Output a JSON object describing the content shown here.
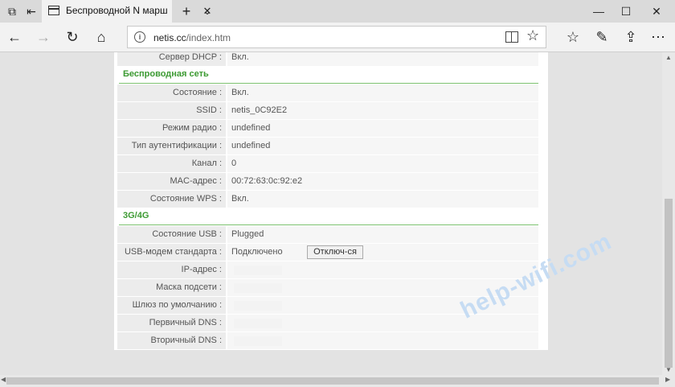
{
  "browser": {
    "tab_title": "Беспроводной N марш",
    "url_host": "netis.cc",
    "url_path": "/index.htm"
  },
  "rows_top": [
    {
      "label": "Сервер DHCP :",
      "value": "Вкл."
    }
  ],
  "sections": [
    {
      "title": "Беспроводная сеть",
      "rows": [
        {
          "label": "Состояние :",
          "value": "Вкл."
        },
        {
          "label": "SSID :",
          "value": "netis_0C92E2"
        },
        {
          "label": "Режим радио :",
          "value": "undefined"
        },
        {
          "label": "Тип аутентификации :",
          "value": "undefined"
        },
        {
          "label": "Канал :",
          "value": "0"
        },
        {
          "label": "MAC-адрес :",
          "value": "00:72:63:0c:92:e2"
        },
        {
          "label": "Состояние WPS :",
          "value": "Вкл."
        }
      ]
    },
    {
      "title": "3G/4G",
      "rows": [
        {
          "label": "Состояние USB :",
          "value": "Plugged"
        },
        {
          "label": "USB-модем стандарта :",
          "value": "Подключено",
          "button": "Отключ-ся"
        },
        {
          "label": "IP-адрес :",
          "value": ""
        },
        {
          "label": "Маска подсети :",
          "value": ""
        },
        {
          "label": "Шлюз по умолчанию :",
          "value": ""
        },
        {
          "label": "Первичный DNS :",
          "value": ""
        },
        {
          "label": "Вторичный DNS :",
          "value": ""
        }
      ]
    }
  ],
  "watermark": "help-wifi.com"
}
